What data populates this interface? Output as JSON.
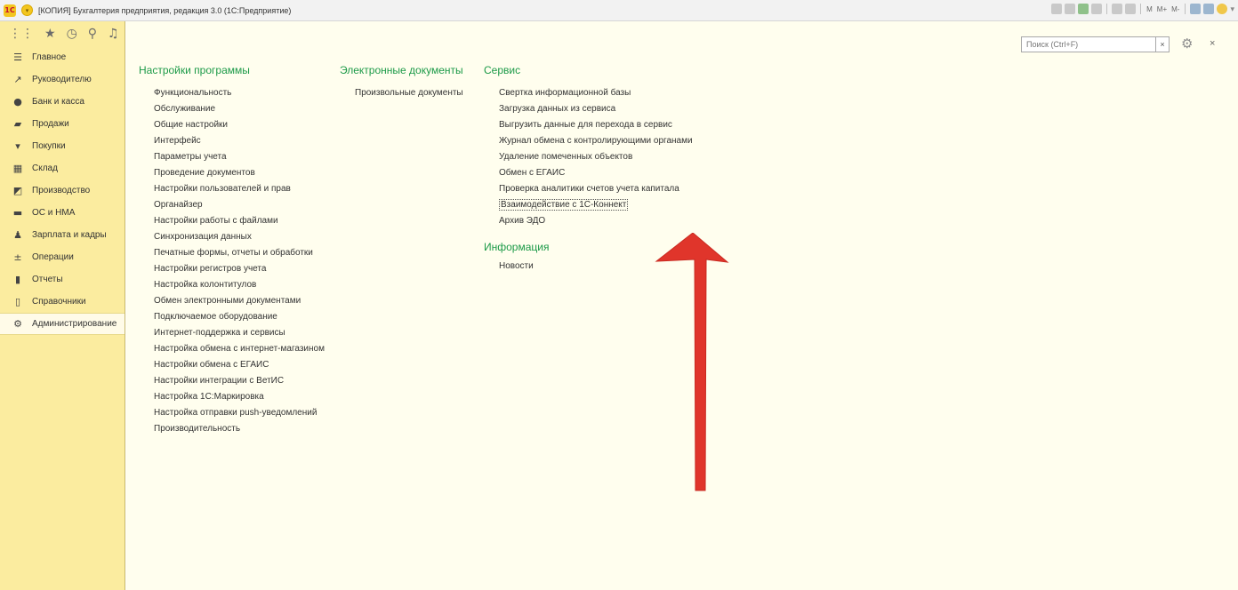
{
  "window": {
    "title": "[КОПИЯ] Бухгалтерия предприятия, редакция 3.0  (1С:Предприятие)",
    "logo_text": "1С",
    "toolbar_m_labels": [
      "M",
      "M+",
      "M-"
    ]
  },
  "sidebar": {
    "items": [
      {
        "label": "Главное",
        "icon": "menu-lines-icon"
      },
      {
        "label": "Руководителю",
        "icon": "trend-icon"
      },
      {
        "label": "Банк и касса",
        "icon": "coin-icon"
      },
      {
        "label": "Продажи",
        "icon": "bag-icon"
      },
      {
        "label": "Покупки",
        "icon": "cart-icon"
      },
      {
        "label": "Склад",
        "icon": "warehouse-icon"
      },
      {
        "label": "Производство",
        "icon": "factory-icon"
      },
      {
        "label": "ОС и НМА",
        "icon": "truck-icon"
      },
      {
        "label": "Зарплата и кадры",
        "icon": "person-icon"
      },
      {
        "label": "Операции",
        "icon": "dt-kt-icon"
      },
      {
        "label": "Отчеты",
        "icon": "bar-chart-icon"
      },
      {
        "label": "Справочники",
        "icon": "book-icon"
      },
      {
        "label": "Администрирование",
        "icon": "gear-icon",
        "active": true
      }
    ]
  },
  "search": {
    "placeholder": "Поиск (Ctrl+F)",
    "clear": "×"
  },
  "close_label": "×",
  "columns": {
    "settings": {
      "title": "Настройки программы",
      "items": [
        "Функциональность",
        "Обслуживание",
        "Общие настройки",
        "Интерфейс",
        "Параметры учета",
        "Проведение документов",
        "Настройки пользователей и прав",
        "Органайзер",
        "Настройки работы с файлами",
        "Синхронизация данных",
        "Печатные формы, отчеты и обработки",
        "Настройки регистров учета",
        "Настройка колонтитулов",
        "Обмен электронными документами",
        "Подключаемое оборудование",
        "Интернет-поддержка и сервисы",
        "Настройка обмена с интернет-магазином",
        "Настройки обмена с ЕГАИС",
        "Настройки интеграции с ВетИС",
        "Настройка 1С:Маркировка",
        "Настройка отправки push-уведомлений",
        "Производительность"
      ]
    },
    "edocs": {
      "title": "Электронные документы",
      "items": [
        "Произвольные документы"
      ]
    },
    "service": {
      "title": "Сервис",
      "items": [
        "Свертка информационной базы",
        "Загрузка данных из сервиса",
        "Выгрузить данные для перехода в сервис",
        "Журнал обмена с контролирующими органами",
        "Удаление помеченных объектов",
        "Обмен с ЕГАИС",
        "Проверка аналитики счетов учета капитала",
        "Взаимодействие с 1С-Коннект",
        "Архив ЭДО"
      ],
      "info_title": "Информация",
      "info_items": [
        "Новости"
      ]
    }
  },
  "colors": {
    "sidebar_bg": "#fbec9f",
    "main_bg": "#fffeee",
    "section_title": "#1c9a48",
    "annotation_arrow": "#e0352b"
  }
}
